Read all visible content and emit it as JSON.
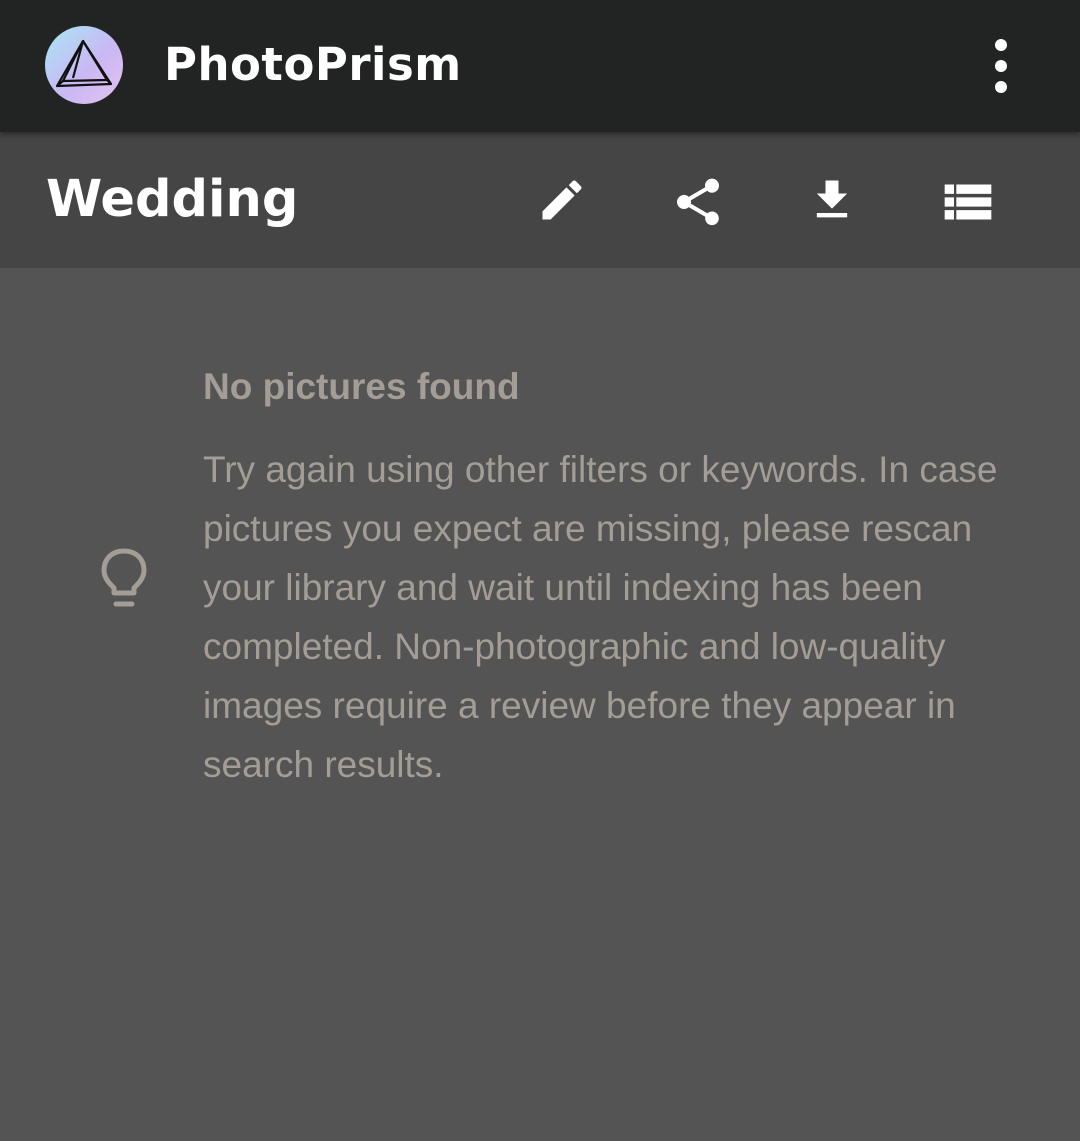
{
  "app": {
    "title": "PhotoPrism",
    "logo_icon": "photoprism-prism-logo",
    "menu_icon": "dots-vertical-icon"
  },
  "album": {
    "title": "Wedding",
    "actions": [
      {
        "icon": "pencil-icon",
        "action": "edit"
      },
      {
        "icon": "share-icon",
        "action": "share"
      },
      {
        "icon": "download-icon",
        "action": "download"
      },
      {
        "icon": "view-list-icon",
        "action": "view"
      }
    ]
  },
  "empty_state": {
    "icon": "lightbulb-outline-icon",
    "title": "No pictures found",
    "message": "Try again using other filters or keywords. In case pictures you expect are missing, please rescan your library and wait until indexing has been completed. Non-photographic and low-quality images require a review before they appear in search results."
  },
  "colors": {
    "app_bar": "#222424",
    "toolbar": "#454545",
    "background": "#545454",
    "muted_text": "#a39d96",
    "text": "#ffffff"
  }
}
